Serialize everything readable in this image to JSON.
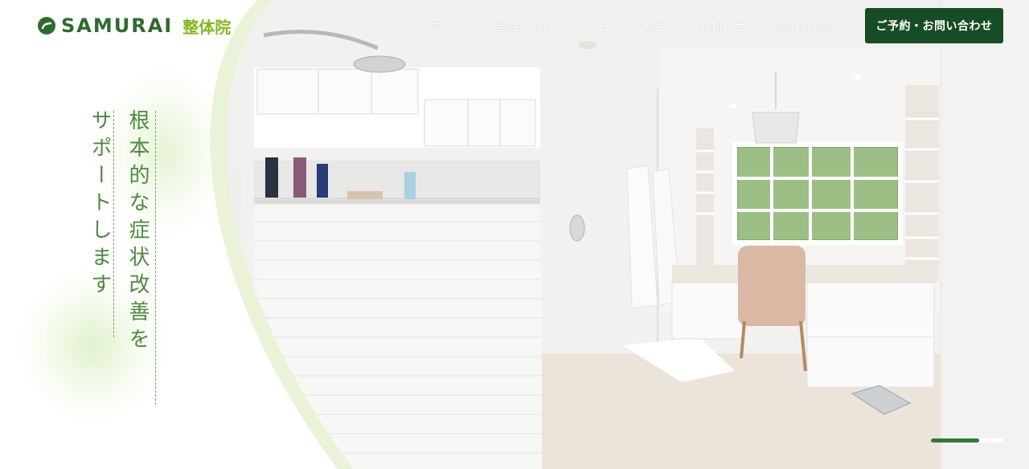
{
  "header": {
    "logo_name": "SAMURAI",
    "logo_sub": "整体院",
    "logo_icon": "samurai-logo-icon",
    "nav": [
      {
        "label": "ホーム"
      },
      {
        "label": "当院について"
      },
      {
        "label": "コース・料金"
      },
      {
        "label": "お知らせ"
      },
      {
        "label": "お客様の声"
      }
    ],
    "cta_label": "ご予約・お問い合わせ"
  },
  "hero": {
    "catch_line1": "根本的な症状改善を",
    "catch_line2": "サポートします",
    "slider": {
      "slides": 2,
      "active": 1
    }
  },
  "colors": {
    "brand_green": "#2f6b2d",
    "accent_lime": "#84b81f",
    "cta_bg": "#174d24",
    "catch_text": "#4c8a3e"
  }
}
